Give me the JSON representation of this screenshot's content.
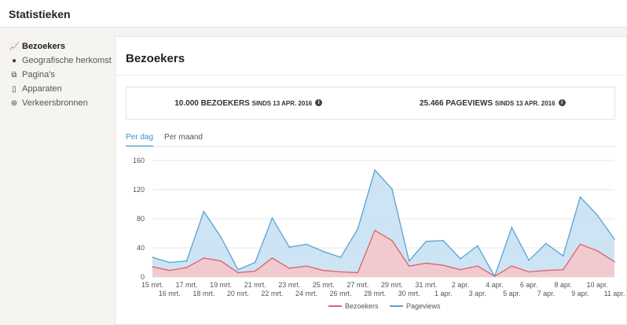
{
  "header": {
    "title": "Statistieken"
  },
  "sidebar": {
    "items": [
      {
        "label": "Bezoekers",
        "icon": "line-chart-icon",
        "active": true
      },
      {
        "label": "Geografische herkomst",
        "icon": "globe-icon"
      },
      {
        "label": "Pagina's",
        "icon": "pages-icon"
      },
      {
        "label": "Apparaten",
        "icon": "mobile-icon"
      },
      {
        "label": "Verkeersbronnen",
        "icon": "network-icon"
      }
    ]
  },
  "main": {
    "title": "Bezoekers",
    "stats": [
      {
        "value": "10.000 BEZOEKERS",
        "since": "SINDS 13 APR. 2016"
      },
      {
        "value": "25.466 PAGEVIEWS",
        "since": "SINDS 13 APR. 2016"
      }
    ],
    "tabs": [
      {
        "label": "Per dag",
        "active": true
      },
      {
        "label": "Per maand"
      }
    ]
  },
  "chart_data": {
    "type": "area",
    "x": [
      "15 mrt.",
      "16 mrt.",
      "17 mrt.",
      "18 mrt.",
      "19 mrt.",
      "20 mrt.",
      "21 mrt.",
      "22 mrt.",
      "23 mrt.",
      "24 mrt.",
      "25 mrt.",
      "26 mrt.",
      "27 mrt.",
      "28 mrt.",
      "29 mrt.",
      "30 mrt.",
      "31 mrt.",
      "1 apr.",
      "2 apr.",
      "3 apr.",
      "4 apr.",
      "5 apr.",
      "6 apr.",
      "7 apr.",
      "8 apr.",
      "9 apr.",
      "10 apr.",
      "11 apr."
    ],
    "yticks": [
      0,
      40,
      80,
      120,
      160
    ],
    "ylim": [
      0,
      160
    ],
    "grid": true,
    "legend": "bottom",
    "series": [
      {
        "name": "Pageviews",
        "color": "#5aa3d0",
        "fill": "#c3dff2",
        "values": [
          27,
          20,
          22,
          90,
          55,
          10,
          20,
          81,
          41,
          45,
          35,
          27,
          66,
          147,
          121,
          22,
          49,
          50,
          25,
          43,
          1,
          68,
          23,
          46,
          29,
          110,
          85,
          52
        ]
      },
      {
        "name": "Bezoekers",
        "color": "#e0606a",
        "fill": "#f7c6c8",
        "values": [
          14,
          9,
          13,
          26,
          22,
          6,
          8,
          26,
          12,
          15,
          9,
          7,
          6,
          64,
          50,
          15,
          19,
          16,
          10,
          15,
          1,
          15,
          7,
          9,
          10,
          45,
          36,
          21
        ]
      }
    ]
  }
}
